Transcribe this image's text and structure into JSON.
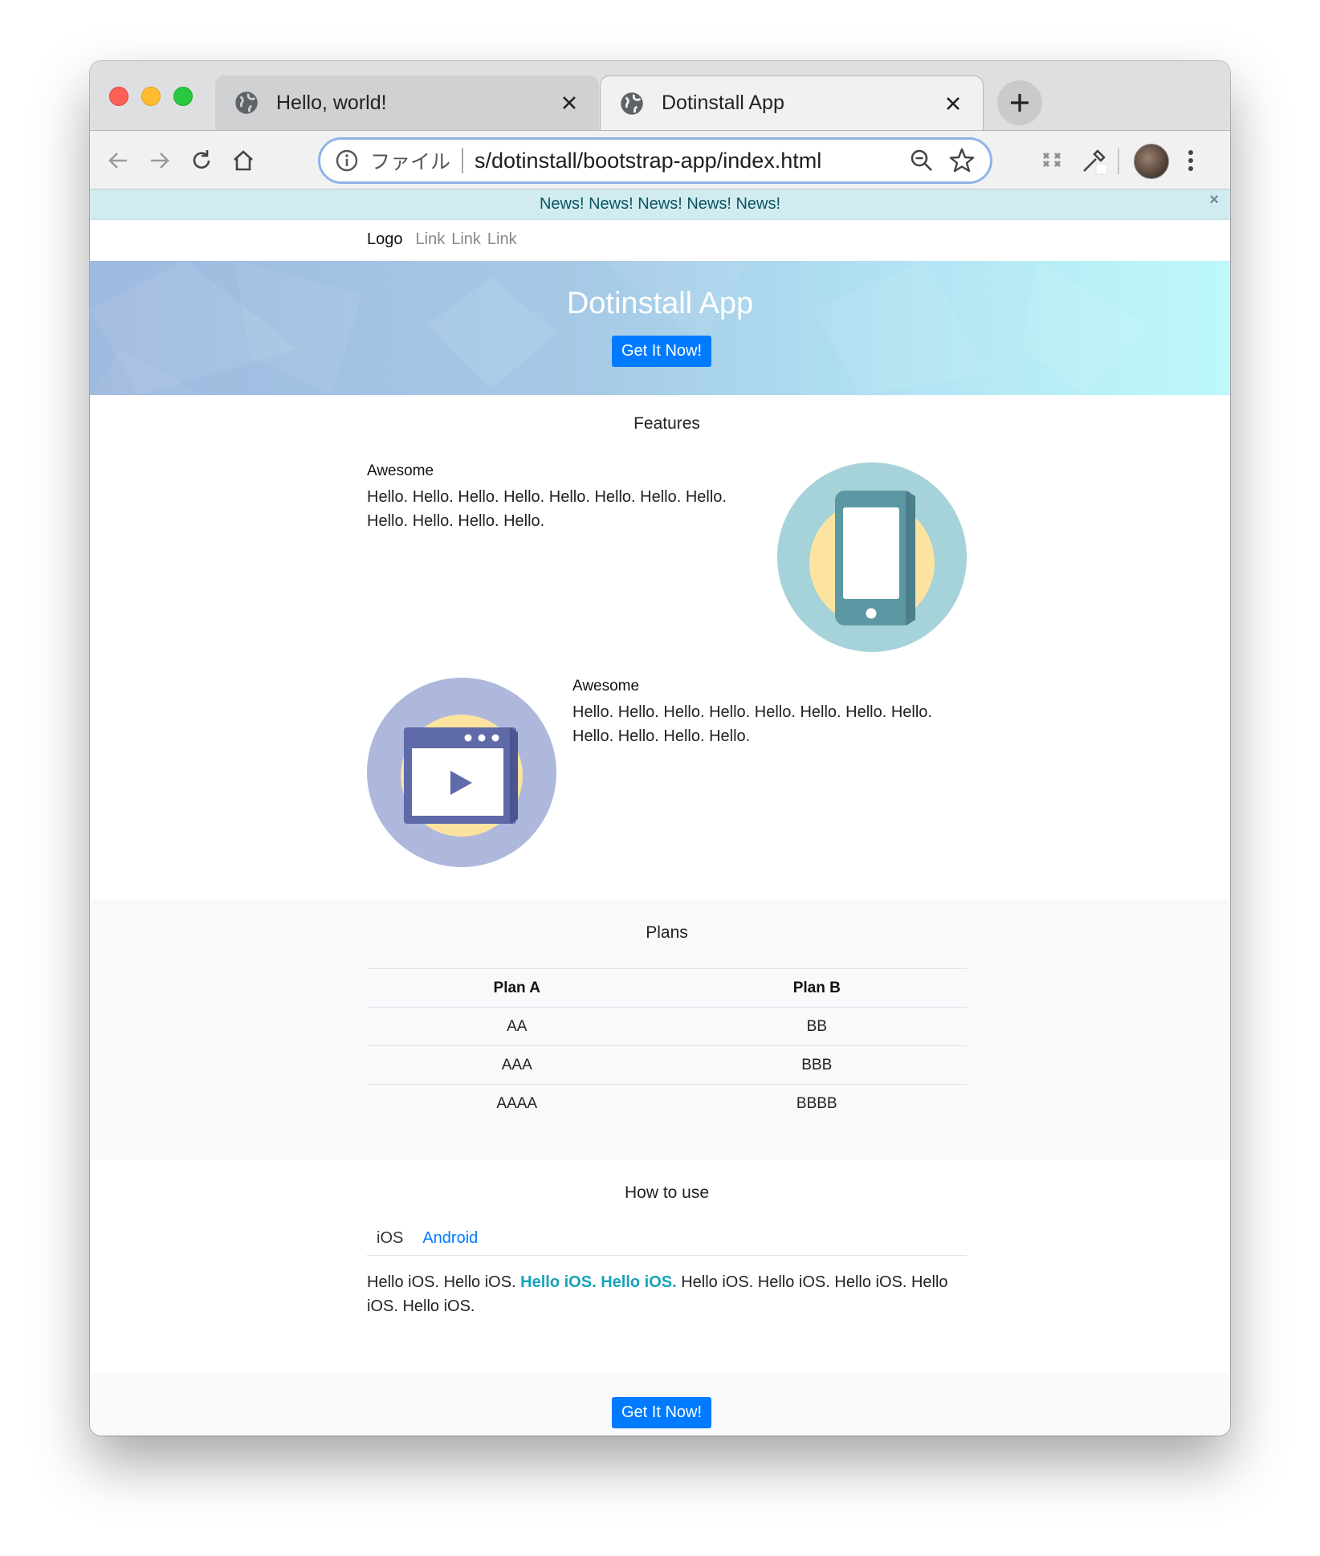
{
  "browser": {
    "tabs": [
      {
        "title": "Hello, world!",
        "active": false
      },
      {
        "title": "Dotinstall App",
        "active": true
      }
    ],
    "omnibox": {
      "scheme_label": "ファイル",
      "url": "s/dotinstall/bootstrap-app/index.html"
    }
  },
  "page": {
    "news": {
      "text": "News! News! News! News! News!",
      "close": "×"
    },
    "navbar": {
      "logo": "Logo",
      "links": [
        "Link",
        "Link",
        "Link"
      ]
    },
    "hero": {
      "title": "Dotinstall App",
      "button": "Get It Now!"
    },
    "features": {
      "title": "Features",
      "items": [
        {
          "heading": "Awesome",
          "body": "Hello. Hello. Hello. Hello. Hello. Hello. Hello. Hello. Hello. Hello. Hello. Hello.",
          "icon": "smartphone-icon"
        },
        {
          "heading": "Awesome",
          "body": "Hello. Hello. Hello. Hello. Hello. Hello. Hello. Hello. Hello. Hello. Hello. Hello.",
          "icon": "video-player-icon"
        }
      ]
    },
    "plans": {
      "title": "Plans",
      "headers": [
        "Plan A",
        "Plan B"
      ],
      "rows": [
        [
          "AA",
          "BB"
        ],
        [
          "AAA",
          "BBB"
        ],
        [
          "AAAA",
          "BBBB"
        ]
      ]
    },
    "howto": {
      "title": "How to use",
      "tabs": [
        "iOS",
        "Android"
      ],
      "text_before": "Hello iOS. Hello iOS. ",
      "text_highlight": "Hello iOS. Hello iOS.",
      "text_after": " Hello iOS. Hello iOS. Hello iOS. Hello iOS. Hello iOS."
    },
    "footer": {
      "button": "Get It Now!"
    }
  },
  "colors": {
    "primary": "#007bff",
    "news_bg": "#d1ecf1",
    "news_text": "#0c5460",
    "highlight": "#17a2b8",
    "section_alt_bg": "#f8f9fa"
  }
}
